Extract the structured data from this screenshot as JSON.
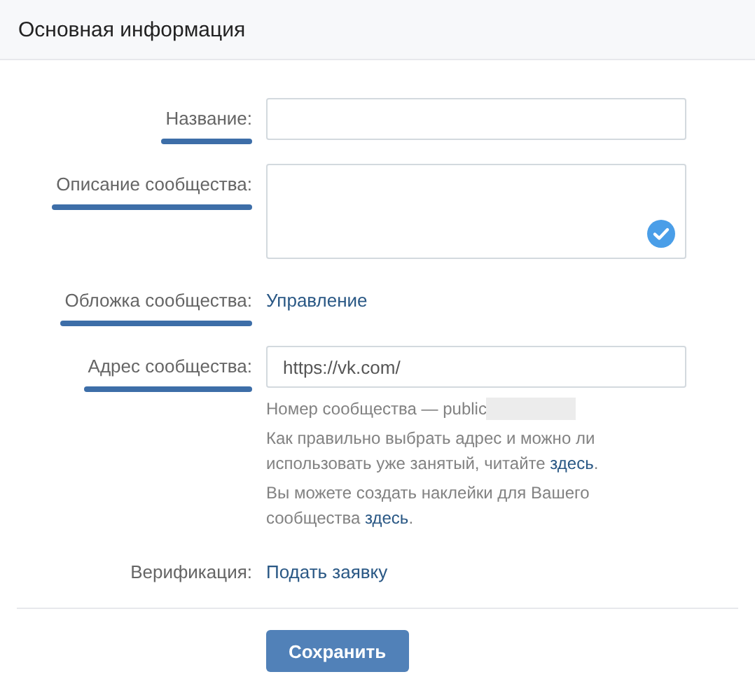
{
  "header": {
    "title": "Основная информация"
  },
  "rows": [
    {
      "kind": "input",
      "label": "Название:",
      "underlined": true
    },
    {
      "kind": "textarea",
      "label": "Описание сообщества:",
      "underlined": true
    },
    {
      "kind": "link",
      "label": "Обложка сообщества:",
      "underlined": true,
      "link": "Управление"
    },
    {
      "kind": "input",
      "label": "Адрес сообщества:",
      "underlined": true,
      "value": "https://vk.com/",
      "hints": [
        {
          "text": "Номер сообщества — public",
          "redacted": true
        },
        {
          "text": "Как правильно выбрать адрес и можно ли использовать уже занятый, читайте ",
          "link": "здесь",
          "after": "."
        },
        {
          "text": "Вы можете создать наклейки для Вашего сообщества ",
          "link": "здесь",
          "after": "."
        }
      ]
    },
    {
      "kind": "link",
      "label": "Верификация:",
      "link": "Подать заявку"
    }
  ],
  "save_button": "Сохранить"
}
